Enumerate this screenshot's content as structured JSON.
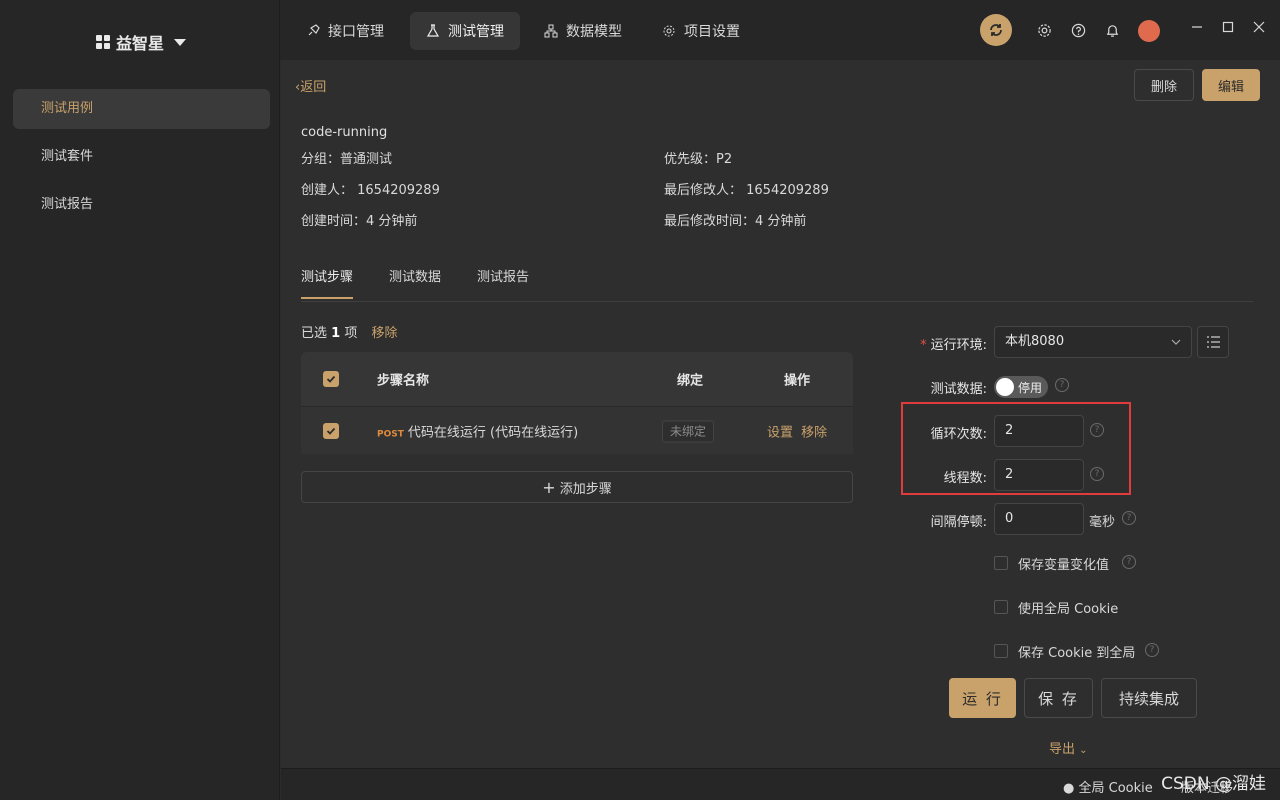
{
  "app": {
    "brand": "益智星"
  },
  "sidebar": {
    "items": [
      {
        "label": "测试用例",
        "active": true
      },
      {
        "label": "测试套件",
        "active": false
      },
      {
        "label": "测试报告",
        "active": false
      }
    ]
  },
  "topbar": {
    "tabs": [
      {
        "label": "接口管理",
        "icon": "rocket-icon"
      },
      {
        "label": "测试管理",
        "icon": "flask-icon",
        "active": true
      },
      {
        "label": "数据模型",
        "icon": "model-icon"
      },
      {
        "label": "项目设置",
        "icon": "gear-icon"
      }
    ]
  },
  "header": {
    "back": "返回",
    "delete": "删除",
    "edit": "编辑"
  },
  "case": {
    "name": "code-running",
    "group": "分组：普通测试",
    "priority": "优先级：P2",
    "creator": "创建人： 1654209289",
    "modifier": "最后修改人： 1654209289",
    "created": "创建时间：4 分钟前",
    "modified": "最后修改时间：4 分钟前"
  },
  "tabs": {
    "steps": "测试步骤",
    "data": "测试数据",
    "report": "测试报告"
  },
  "selection": {
    "prefix": "已选",
    "count": "1",
    "suffix": "项",
    "remove": "移除"
  },
  "table": {
    "headers": {
      "name": "步骤名称",
      "bind": "绑定",
      "ops": "操作"
    },
    "rows": [
      {
        "method": "POST",
        "name": "代码在线运行 (代码在线运行)",
        "bind": "未绑定",
        "set": "设置",
        "remove": "移除"
      }
    ],
    "add": "添加步骤"
  },
  "form": {
    "env_label": "运行环境:",
    "env_value": "本机8080",
    "testdata_label": "测试数据:",
    "testdata_toggle": "停用",
    "loops_label": "循环次数:",
    "loops_value": "2",
    "threads_label": "线程数:",
    "threads_value": "2",
    "interval_label": "间隔停顿:",
    "interval_value": "0",
    "interval_unit": "毫秒",
    "cb_save_vars": "保存变量变化值",
    "cb_global_cookie": "使用全局 Cookie",
    "cb_save_cookie": "保存 Cookie 到全局"
  },
  "actions": {
    "run": "运 行",
    "save": "保 存",
    "ci": "持续集成",
    "export": "导出"
  },
  "status": {
    "cookie": "全局 Cookie",
    "version": "版本迁移"
  },
  "watermark": "CSDN @溜娃",
  "colors": {
    "accent": "#c9a26b",
    "highlight": "#e23b3b"
  }
}
